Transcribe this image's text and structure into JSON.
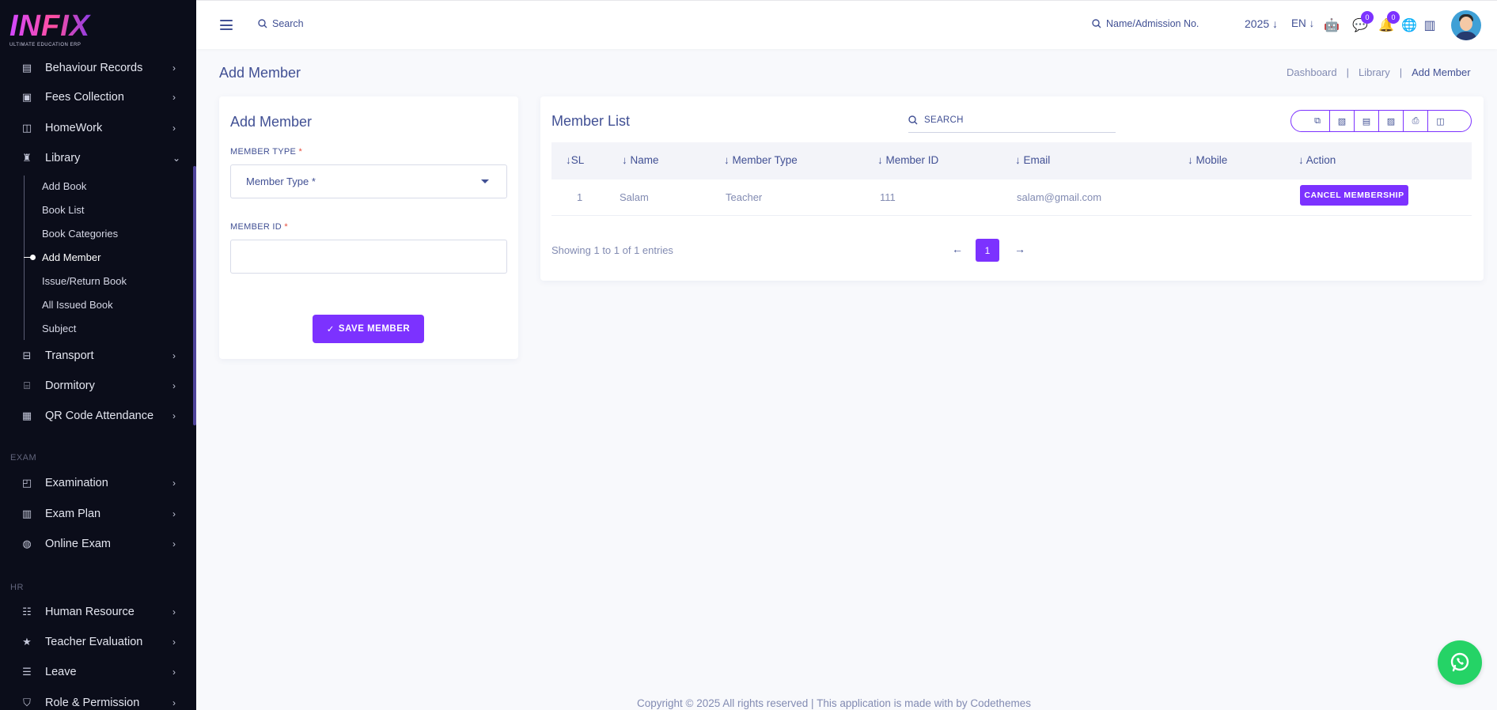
{
  "brand": {
    "logo_text": "INFIX",
    "logo_tagline": "ULTIMATE EDUCATION ERP"
  },
  "sidebar": {
    "items_top": [
      {
        "label": "Behaviour Records",
        "icon": "clipboard-icon"
      },
      {
        "label": "Fees Collection",
        "icon": "wallet-icon"
      },
      {
        "label": "HomeWork",
        "icon": "book-open-icon"
      },
      {
        "label": "Library",
        "icon": "library-icon"
      }
    ],
    "library_sub": [
      "Add Book",
      "Book List",
      "Book Categories",
      "Add Member",
      "Issue/Return Book",
      "All Issued Book",
      "Subject"
    ],
    "items_mid": [
      {
        "label": "Transport",
        "icon": "bus-icon"
      },
      {
        "label": "Dormitory",
        "icon": "bed-icon"
      },
      {
        "label": "QR Code Attendance",
        "icon": "qr-icon"
      }
    ],
    "section_exam": "EXAM",
    "items_exam": [
      {
        "label": "Examination",
        "icon": "map-icon"
      },
      {
        "label": "Exam Plan",
        "icon": "document-icon"
      },
      {
        "label": "Online Exam",
        "icon": "globe-icon"
      }
    ],
    "section_hr": "HR",
    "items_hr": [
      {
        "label": "Human Resource",
        "icon": "users-icon"
      },
      {
        "label": "Teacher Evaluation",
        "icon": "star-icon"
      },
      {
        "label": "Leave",
        "icon": "list-icon"
      },
      {
        "label": "Role & Permission",
        "icon": "shield-icon"
      }
    ]
  },
  "header": {
    "search_label": "Search",
    "name_search_label": "Name/Admission No.",
    "year": "2025",
    "language": "EN",
    "chat_badge": "0",
    "notification_badge": "0"
  },
  "page": {
    "title": "Add Member",
    "breadcrumb": [
      "Dashboard",
      "Library",
      "Add Member"
    ]
  },
  "form": {
    "title": "Add Member",
    "member_type_label": "MEMBER TYPE",
    "member_type_placeholder": "Member Type *",
    "member_id_label": "MEMBER ID",
    "member_id_value": "",
    "required_mark": "*",
    "save_label": "SAVE MEMBER"
  },
  "list": {
    "title": "Member List",
    "search_label": "SEARCH",
    "columns": [
      "SL",
      "Name",
      "Member Type",
      "Member ID",
      "Email",
      "Mobile",
      "Action"
    ],
    "rows": [
      {
        "sl": "1",
        "name": "Salam",
        "member_type": "Teacher",
        "member_id": "111",
        "email": "salam@gmail.com",
        "mobile": "",
        "action": "CANCEL MEMBERSHIP"
      }
    ],
    "showing": "Showing 1 to 1 of 1 entries",
    "current_page": "1",
    "tool_icons": [
      "copy-icon",
      "excel-icon",
      "csv-icon",
      "pdf-icon",
      "print-icon",
      "columns-icon"
    ]
  },
  "footer": {
    "text": "Copyright © 2025 All rights reserved | This application is made with by Codethemes"
  },
  "colors": {
    "accent": "#7c32ff",
    "sidebar_bg": "#0b0d1a",
    "text": "#415094",
    "whatsapp": "#25d366"
  }
}
